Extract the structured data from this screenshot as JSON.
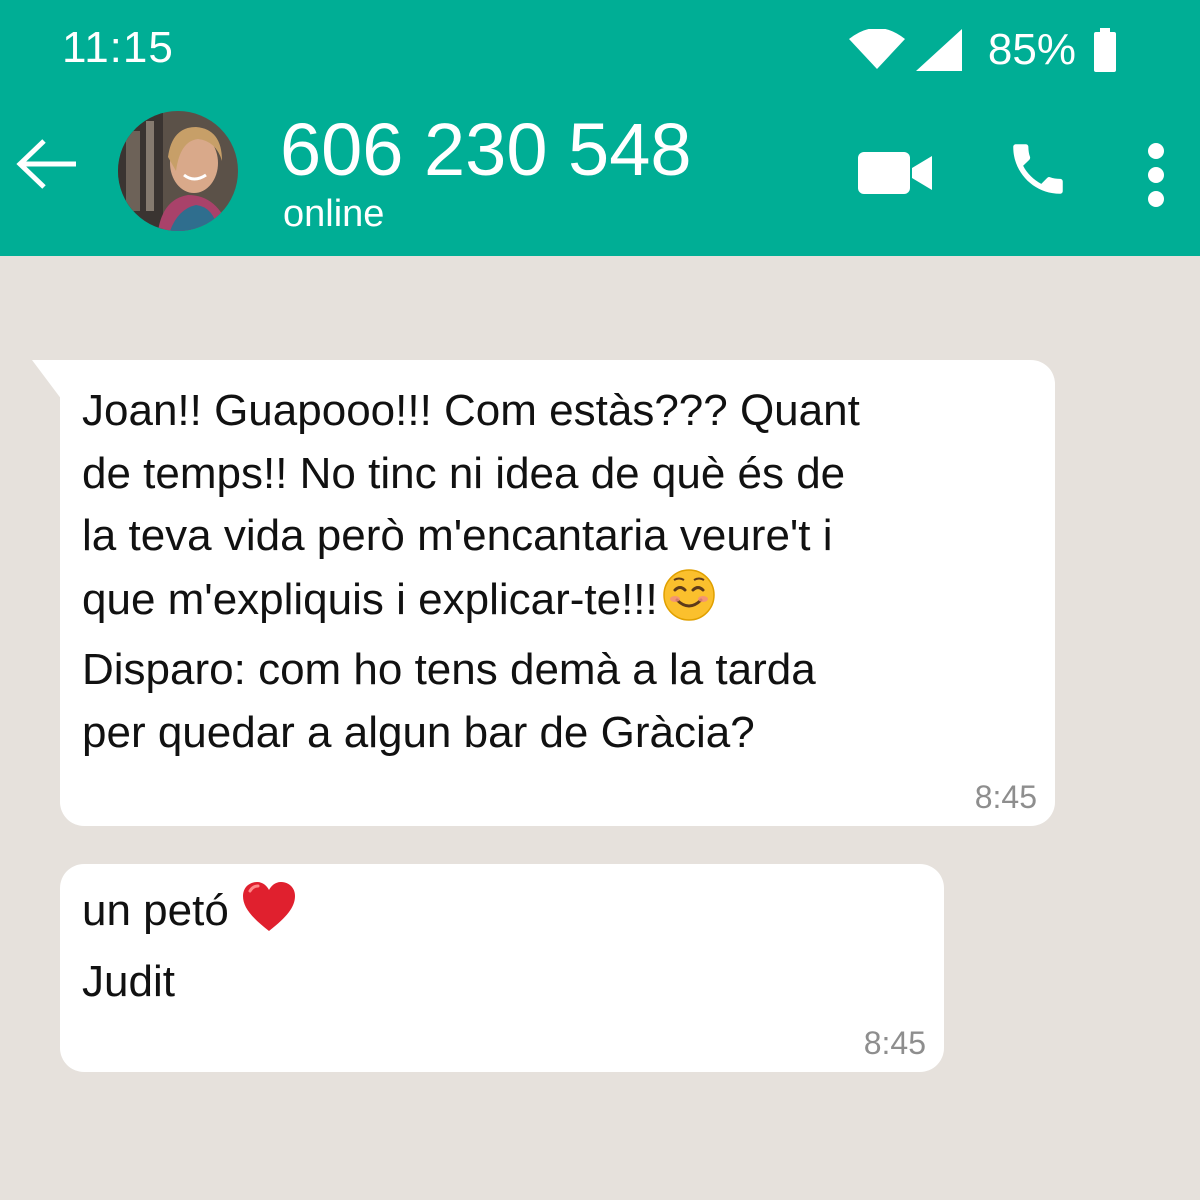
{
  "status_bar": {
    "time": "11:15",
    "battery_percent": "85%",
    "icons": [
      "wifi-icon",
      "cell-signal-icon",
      "battery-icon"
    ]
  },
  "header": {
    "contact_name": "606 230 548",
    "contact_status": "online",
    "icons": [
      "back-arrow-icon",
      "avatar",
      "video-call-icon",
      "phone-call-icon",
      "more-options-icon"
    ]
  },
  "colors": {
    "header_bg": "#00ae95",
    "chat_bg": "#e6e1dc",
    "bubble_bg": "#ffffff",
    "timestamp": "#8e8e8e"
  },
  "messages": [
    {
      "line_1": "Joan!! Guapooo!!! Com estàs??? Quant",
      "line_2": "de temps!! No tinc ni idea de què és de",
      "line_3": "la teva vida però m'encantaria veure't i",
      "line_4": "que m'expliquis i explicar-te!!!",
      "line_4_emoji": "smiling-face-emoji",
      "line_5": "Disparo: com ho tens demà a la tarda",
      "line_6": "per quedar a algun bar de Gràcia?",
      "time": "8:45"
    },
    {
      "line_1": "un petó",
      "line_1_emoji": "red-heart-emoji",
      "line_2": "Judit",
      "time": "8:45"
    }
  ]
}
